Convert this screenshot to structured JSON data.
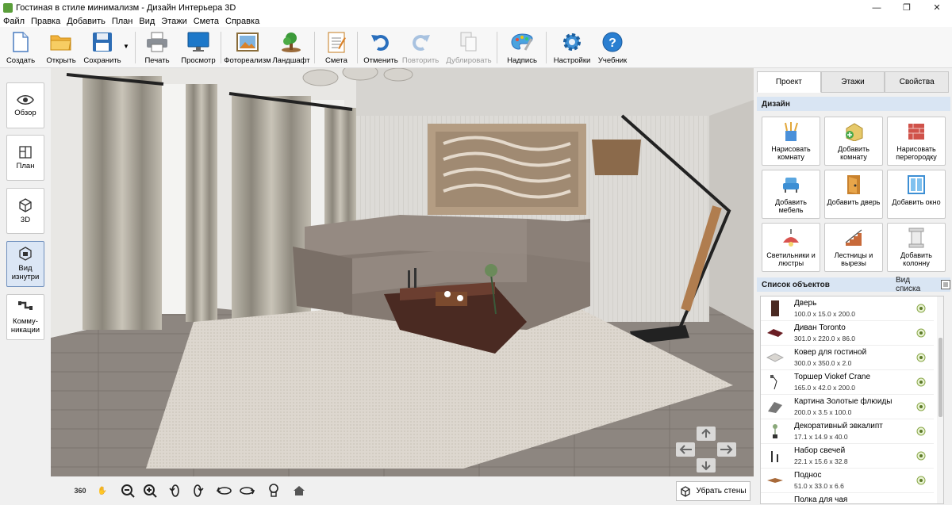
{
  "window": {
    "title": "Гостиная в стиле минимализм - Дизайн Интерьера 3D"
  },
  "menu": [
    "Файл",
    "Правка",
    "Добавить",
    "План",
    "Вид",
    "Этажи",
    "Смета",
    "Справка"
  ],
  "toolbar": {
    "create": "Создать",
    "open": "Открыть",
    "save": "Сохранить",
    "print": "Печать",
    "preview": "Просмотр",
    "photoreal": "Фотореализм",
    "landscape": "Ландшафт",
    "estimate": "Смета",
    "undo": "Отменить",
    "redo": "Повторить",
    "duplicate": "Дублировать",
    "caption": "Надпись",
    "settings": "Настройки",
    "tutorial": "Учебник"
  },
  "left": {
    "overview": "Обзор",
    "plan": "План",
    "view3d": "3D",
    "inside": "Вид изнутри",
    "comm": "Комму-никации"
  },
  "bottom": {
    "remove_walls": "Убрать стены",
    "rotate360": "360"
  },
  "right": {
    "tabs": [
      "Проект",
      "Этажи",
      "Свойства"
    ],
    "design_title": "Дизайн",
    "design_buttons": [
      "Нарисовать комнату",
      "Добавить комнату",
      "Нарисовать перегородку",
      "Добавить мебель",
      "Добавить дверь",
      "Добавить окно",
      "Светильники и люстры",
      "Лестницы и вырезы",
      "Добавить колонну"
    ],
    "objects_title": "Список объектов",
    "view_list": "Вид списка",
    "objects": [
      {
        "name": "Дверь",
        "dims": "100.0 x 15.0 x 200.0"
      },
      {
        "name": "Диван Toronto",
        "dims": "301.0 x 220.0 x 86.0"
      },
      {
        "name": "Ковер для гостиной",
        "dims": "300.0 x 350.0 x 2.0"
      },
      {
        "name": "Торшер Viokef Crane",
        "dims": "165.0 x 42.0 x 200.0"
      },
      {
        "name": "Картина Золотые флюиды",
        "dims": "200.0 x 3.5 x 100.0"
      },
      {
        "name": "Декоративный эвкалипт",
        "dims": "17.1 x 14.9 x 40.0"
      },
      {
        "name": "Набор свечей",
        "dims": "22.1 x 15.6 x 32.8"
      },
      {
        "name": "Поднос",
        "dims": "51.0 x 33.0 x 6.6"
      },
      {
        "name": "Полка для чая",
        "dims": ""
      }
    ]
  },
  "colors": {
    "accent": "#1f6fc5",
    "header_bg": "#d9e5f3",
    "active_left": "#dbe6f5"
  }
}
